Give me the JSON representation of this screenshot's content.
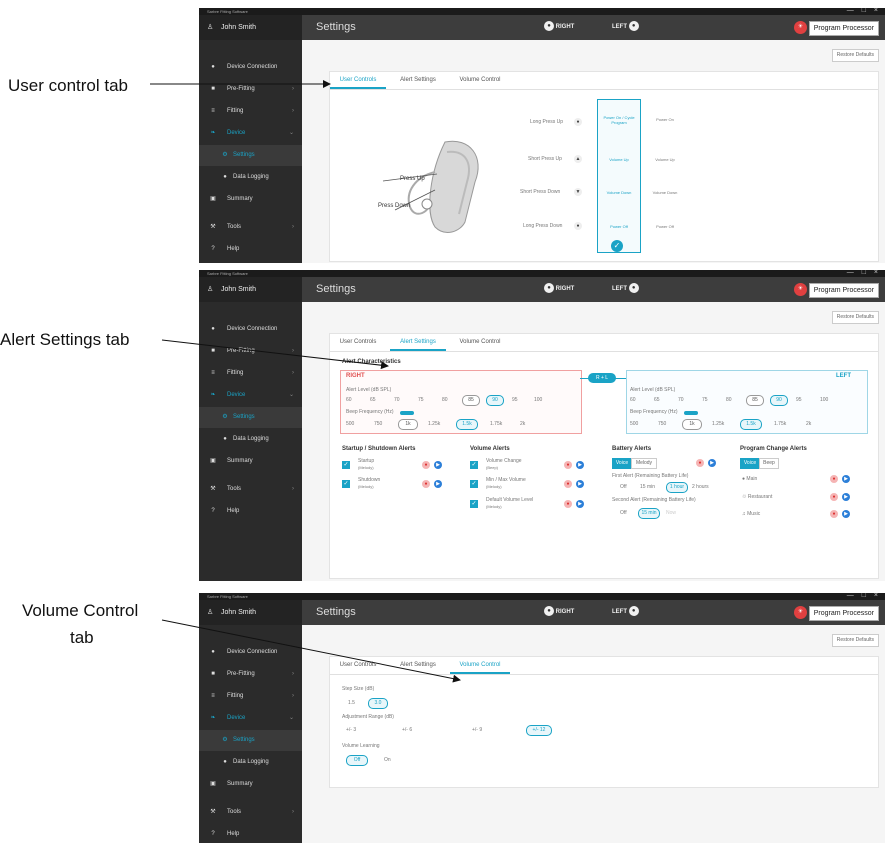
{
  "callouts": {
    "user_controls": "User control tab",
    "alert_settings": "Alert Settings tab",
    "volume_control_1": "Volume Control",
    "volume_control_2": "tab"
  },
  "app": {
    "window_title": "Sarbre Fitting Software",
    "user_name": "John Smith",
    "page_title": "Settings",
    "right_label": "RIGHT",
    "left_label": "LEFT",
    "program_processor": "Program Processor",
    "restore_defaults": "Restore Defaults",
    "accent": "#1aa3c6"
  },
  "sidebar": {
    "items": [
      {
        "label": "Device Connection",
        "icon": "plug-icon"
      },
      {
        "label": "Pre-Fitting",
        "icon": "list-icon"
      },
      {
        "label": "Fitting",
        "icon": "sliders-icon"
      },
      {
        "label": "Device",
        "icon": "hearing-aid-icon"
      },
      {
        "label": "Settings",
        "icon": "gear-icon"
      },
      {
        "label": "Data Logging",
        "icon": "chart-icon"
      },
      {
        "label": "Summary",
        "icon": "document-icon"
      },
      {
        "label": "Tools",
        "icon": "wrench-icon"
      },
      {
        "label": "Help",
        "icon": "question-icon"
      }
    ]
  },
  "tabs": [
    "User Controls",
    "Alert Settings",
    "Volume Control"
  ],
  "user_controls": {
    "rows": [
      "Long Press Up",
      "Short Press Up",
      "Short Press Down",
      "Long Press Down"
    ],
    "selected_col": [
      "Power On / Cycle Program",
      "Volume Up",
      "Volume Down",
      "Power Off"
    ],
    "other_col": [
      "Power On",
      "Volume Up",
      "Volume Down",
      "Power Off"
    ],
    "press_up": "Press Up",
    "press_down": "Press Down"
  },
  "alerts": {
    "title": "Alert Characteristics",
    "right": "RIGHT",
    "left": "LEFT",
    "link": "R + L",
    "level_label": "Alert Level (dB SPL)",
    "levels": [
      "60",
      "65",
      "70",
      "75",
      "80",
      "85",
      "90",
      "95",
      "100"
    ],
    "freq_label": "Beep Frequency (Hz)",
    "freqs": [
      "500",
      "750",
      "1k",
      "1.25k",
      "1.5k",
      "1.75k",
      "2k"
    ],
    "startup_title": "Startup / Shutdown Alerts",
    "startup_items": [
      [
        "Startup",
        "(Melody)"
      ],
      [
        "Shutdown",
        "(Melody)"
      ]
    ],
    "volume_title": "Volume Alerts",
    "volume_items": [
      [
        "Volume Change",
        "(Beep)"
      ],
      [
        "Min / Max Volume",
        "(Melody)"
      ],
      [
        "Default Volume Level",
        "(Melody)"
      ]
    ],
    "battery_title": "Battery Alerts",
    "voice": "Voice",
    "melody": "Melody",
    "beep": "Beep",
    "first_alert": "First Alert (Remaining Battery Life)",
    "first_opts": [
      "Off",
      "15 min",
      "1 hour",
      "2 hours"
    ],
    "second_alert": "Second Alert (Remaining Battery Life)",
    "second_opts": [
      "Off",
      "15 min",
      "Now"
    ],
    "program_title": "Program Change Alerts",
    "programs": [
      "Main",
      "Restaurant",
      "Music"
    ]
  },
  "volume_control": {
    "step_label": "Step Size (dB)",
    "steps": [
      "1.5",
      "3.0"
    ],
    "range_label": "Adjustment Range (dB)",
    "ranges": [
      "+/- 3",
      "+/- 6",
      "+/- 9",
      "+/- 12"
    ],
    "learning_label": "Volume Learning",
    "learning": [
      "Off",
      "On"
    ]
  }
}
